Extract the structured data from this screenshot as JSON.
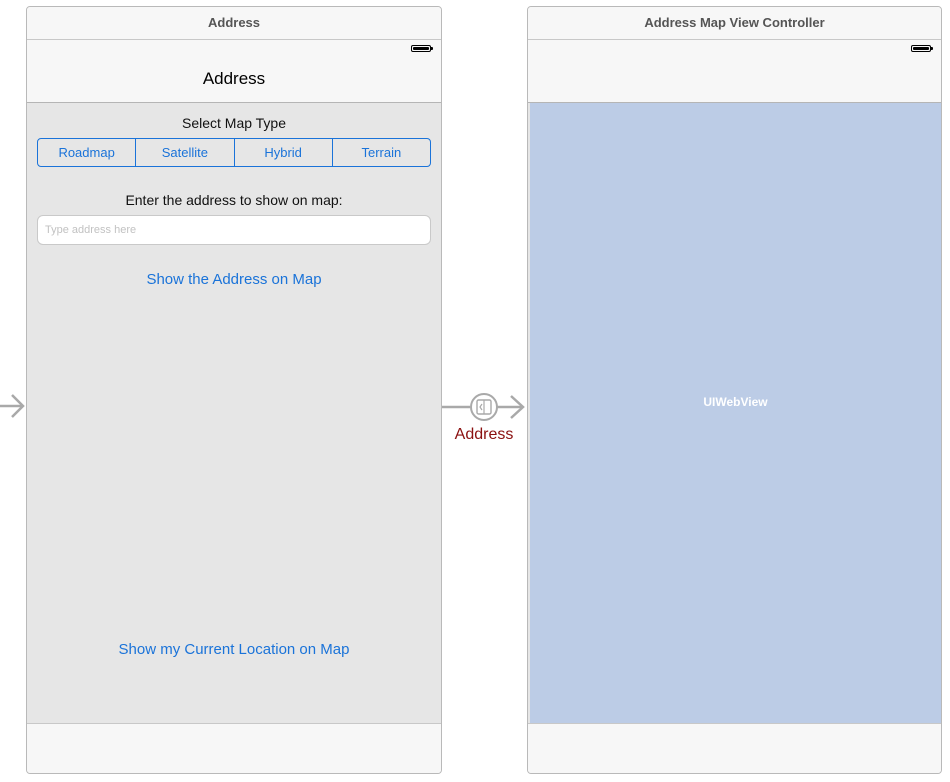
{
  "scenes": {
    "address": {
      "title": "Address",
      "nav_title": "Address",
      "select_map_type_label": "Select Map Type",
      "map_types": [
        "Roadmap",
        "Satellite",
        "Hybrid",
        "Terrain"
      ],
      "address_prompt": "Enter the address to show on map:",
      "address_placeholder": "Type address here",
      "address_value": "",
      "show_address_button": "Show the Address on Map",
      "show_location_button": "Show my Current Location on Map"
    },
    "map": {
      "title": "Address Map View Controller",
      "web_view_label": "UIWebView"
    }
  },
  "segue": {
    "label": "Address",
    "icon": "segue-push-icon"
  },
  "entry": {
    "icon": "initial-view-controller-arrow-icon"
  },
  "colors": {
    "tint": "#1a73d9",
    "segue_label": "#8b1010",
    "web_view_bg": "#bccce6",
    "content_bg": "#e6e6e6"
  }
}
